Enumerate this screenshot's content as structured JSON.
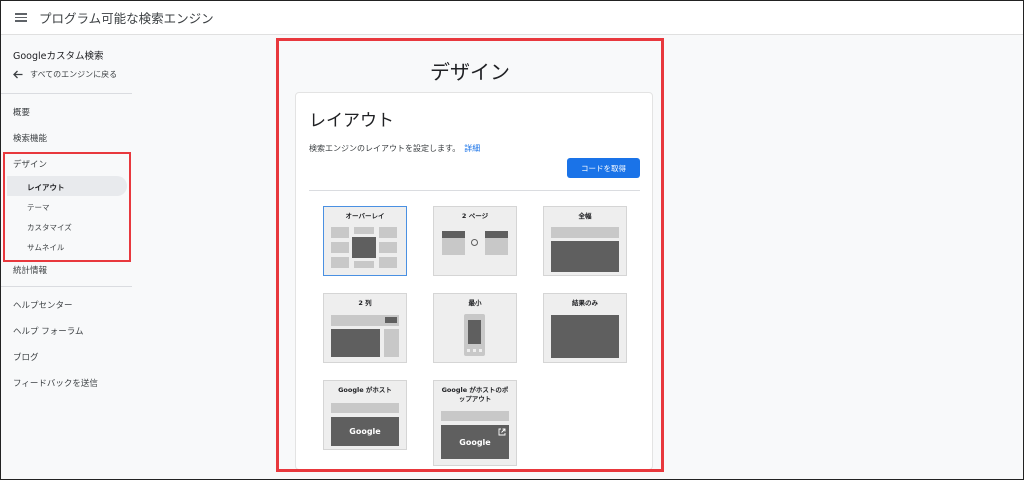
{
  "header": {
    "title": "プログラム可能な検索エンジン",
    "menu_icon": "hamburger-menu-icon"
  },
  "sidebar": {
    "product": "Googleカスタム検索",
    "back_label": "すべてのエンジンに戻る",
    "items": [
      "概要",
      "検索機能",
      "デザイン"
    ],
    "design_subitems": [
      "レイアウト",
      "テーマ",
      "カスタマイズ",
      "サムネイル"
    ],
    "stats": "統計情報",
    "footer_items": [
      "ヘルプセンター",
      "ヘルプ フォーラム",
      "ブログ",
      "フィードバックを送信"
    ]
  },
  "main": {
    "page_title": "デザイン",
    "card": {
      "title": "レイアウト",
      "description": "検索エンジンのレイアウトを設定します。",
      "link": "詳細",
      "get_code_button": "コードを取得",
      "options": [
        {
          "label": "オーバーレイ",
          "selected": true
        },
        {
          "label": "2 ページ",
          "selected": false
        },
        {
          "label": "全幅",
          "selected": false
        },
        {
          "label": "2 列",
          "selected": false
        },
        {
          "label": "最小",
          "selected": false
        },
        {
          "label": "結果のみ",
          "selected": false
        },
        {
          "label": "Google がホスト",
          "selected": false
        },
        {
          "label_line1": "Google がホストのポ",
          "label_line2": "ップアウト",
          "selected": false
        }
      ],
      "google_logo_text": "Google"
    }
  },
  "colors": {
    "accent": "#1a73e8",
    "highlight": "#e8383d"
  }
}
